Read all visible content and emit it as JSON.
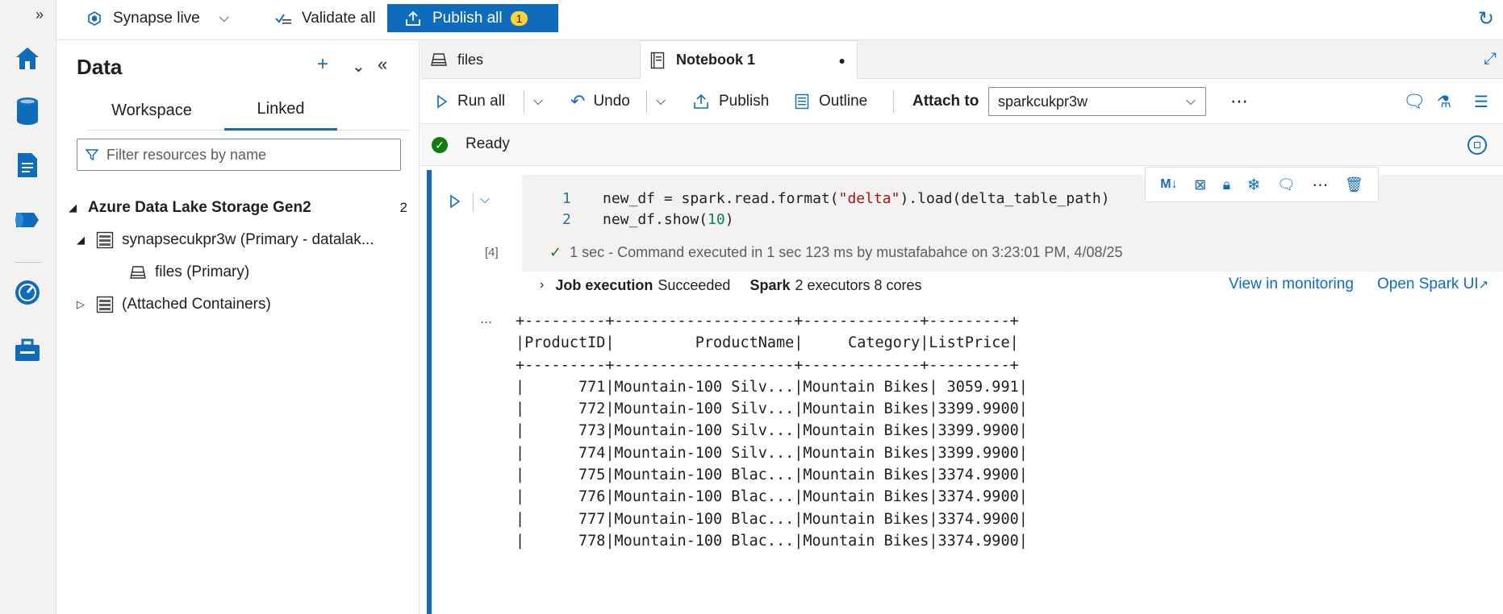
{
  "topbar": {
    "workspace_label": "Synapse live",
    "validate_label": "Validate all",
    "publish_label": "Publish all",
    "publish_count": "1"
  },
  "data_panel": {
    "title": "Data",
    "tabs": [
      {
        "label": "Workspace"
      },
      {
        "label": "Linked"
      }
    ],
    "filter_placeholder": "Filter resources by name",
    "tree": {
      "section_label": "Azure Data Lake Storage Gen2",
      "section_count": "2",
      "account_label": "synapsecukpr3w (Primary - datalak...",
      "container_label": "files (Primary)",
      "attached_label": "(Attached Containers)"
    }
  },
  "editor": {
    "tabs": [
      {
        "label": "files"
      },
      {
        "label": "Notebook 1"
      }
    ],
    "toolbar": {
      "run_all": "Run all",
      "undo": "Undo",
      "publish": "Publish",
      "outline": "Outline",
      "attach_to": "Attach to",
      "spark_pool": "sparkcukpr3w"
    },
    "status": "Ready",
    "cell": {
      "exec_count": "[4]",
      "line_numbers": [
        "1",
        "2"
      ],
      "exec_info": "1 sec - Command executed in 1 sec 123 ms by mustafabahce on 3:23:01 PM, 4/08/25",
      "job_label": "Job execution",
      "job_status": "Succeeded",
      "spark_label": "Spark",
      "spark_info": "2 executors 8 cores",
      "view_monitoring": "View in monitoring",
      "open_spark_ui": "Open Spark UI",
      "more": "...",
      "output_lines": [
        "+---------+--------------------+-------------+---------+",
        "|ProductID|         ProductName|     Category|ListPrice|",
        "+---------+--------------------+-------------+---------+",
        "|      771|Mountain-100 Silv...|Mountain Bikes| 3059.991|",
        "|      772|Mountain-100 Silv...|Mountain Bikes|3399.9900|",
        "|      773|Mountain-100 Silv...|Mountain Bikes|3399.9900|",
        "|      774|Mountain-100 Silv...|Mountain Bikes|3399.9900|",
        "|      775|Mountain-100 Blac...|Mountain Bikes|3374.9900|",
        "|      776|Mountain-100 Blac...|Mountain Bikes|3374.9900|",
        "|      777|Mountain-100 Blac...|Mountain Bikes|3374.9900|",
        "|      778|Mountain-100 Blac...|Mountain Bikes|3374.9900|"
      ]
    }
  },
  "colors": {
    "accent": "#0f6cbd",
    "badge": "#ffd335",
    "success": "#107c10"
  }
}
